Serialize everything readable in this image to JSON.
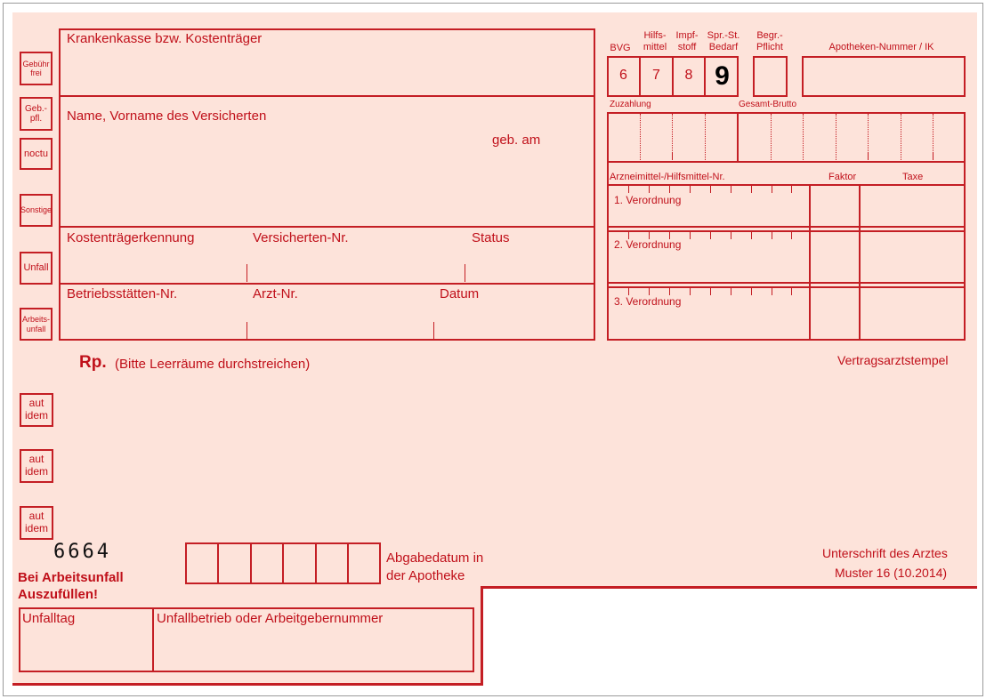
{
  "header_fields": {
    "krankenkasse_label": "Krankenkasse bzw. Kostenträger",
    "name_label": "Name, Vorname des Versicherten",
    "geb_label": "geb. am",
    "kostentraeger_label": "Kostenträgerkennung",
    "versicherten_label": "Versicherten-Nr.",
    "status_label": "Status",
    "betrieb_label": "Betriebsstätten-Nr.",
    "arzt_label": "Arzt-Nr.",
    "datum_label": "Datum"
  },
  "left_checkboxes": {
    "gebuehr_frei": "Gebühr frei",
    "geb_pfl": "Geb.- pfl.",
    "noctu": "noctu",
    "sonstige": "Sonstige",
    "unfall": "Unfall",
    "arbeitsunfall": "Arbeits- unfall"
  },
  "aut_idem": [
    "aut idem",
    "aut idem",
    "aut idem"
  ],
  "top_codes": {
    "bvg_label": "BVG",
    "hilfsmittel_label": "Hilfs- mittel",
    "impfstoff_label": "Impf- stoff",
    "spr_label": "Spr.-St. Bedarf",
    "begr_label": "Begr.- Pflicht",
    "apotheken_label": "Apotheken-Nummer / IK",
    "digits": [
      "6",
      "7",
      "8",
      "9"
    ]
  },
  "pharmacy": {
    "zuzahlung_label": "Zuzahlung",
    "gesamt_label": "Gesamt-Brutto",
    "arzneimittel_label": "Arzneimittel-/Hilfsmittel-Nr.",
    "faktor_label": "Faktor",
    "taxe_label": "Taxe",
    "verordnungen": [
      "1. Verordnung",
      "2. Verordnung",
      "3. Verordnung"
    ]
  },
  "rp": {
    "rp_label": "Rp.",
    "instruction": "(Bitte Leerräume durchstreichen)"
  },
  "stamp_label": "Vertragsarztstempel",
  "form_code": "6664",
  "abgabedatum_label": "Abgabedatum in der Apotheke",
  "signature_label": "Unterschrift des Arztes",
  "muster_label": "Muster 16 (10.2014)",
  "arbeitsunfall_note": "Bei Arbeitsunfall Auszufüllen!",
  "unfall": {
    "unfalltag_label": "Unfalltag",
    "unfallbetrieb_label": "Unfallbetrieb oder Arbeitgebernummer"
  }
}
